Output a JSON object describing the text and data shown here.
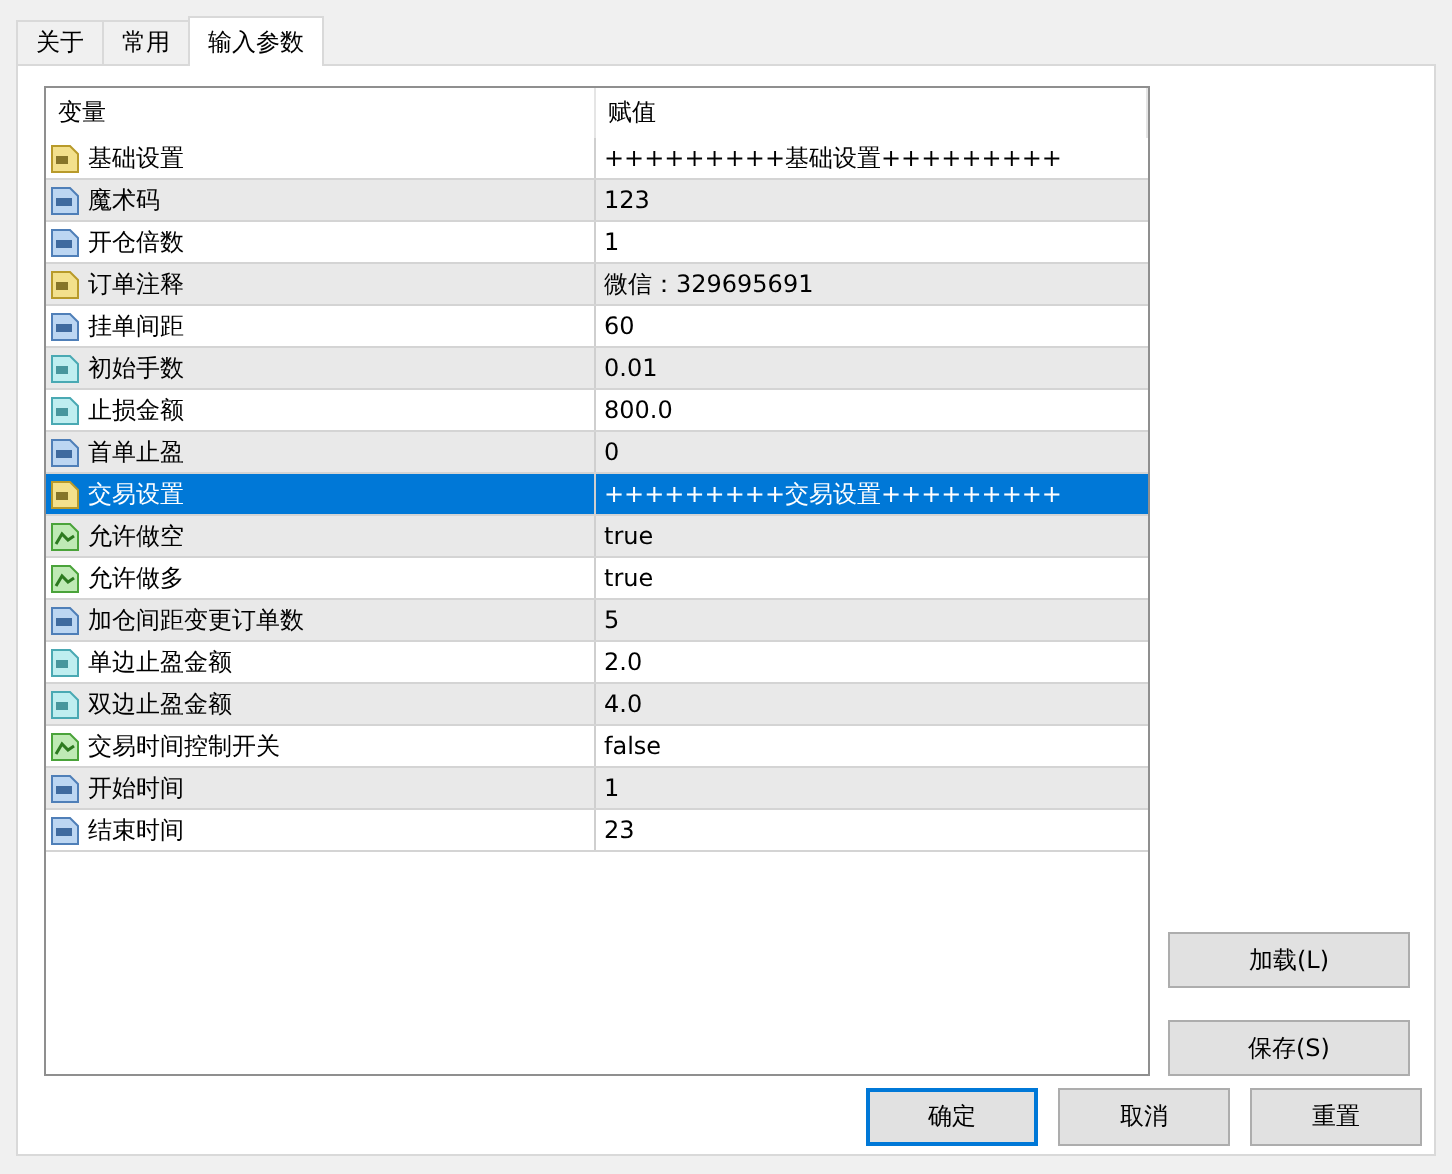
{
  "tabs": [
    {
      "label": "关于",
      "selected": false
    },
    {
      "label": "常用",
      "selected": false
    },
    {
      "label": "输入参数",
      "selected": true
    }
  ],
  "table": {
    "columns": [
      "变量",
      "赋值"
    ],
    "rows": [
      {
        "kind": "string",
        "name": "基础设置",
        "value": "+++++++++基础设置+++++++++",
        "selected": false
      },
      {
        "kind": "int",
        "name": "魔术码",
        "value": "123",
        "selected": false
      },
      {
        "kind": "int",
        "name": "开仓倍数",
        "value": "1",
        "selected": false
      },
      {
        "kind": "string",
        "name": "订单注释",
        "value": "微信：329695691",
        "selected": false
      },
      {
        "kind": "int",
        "name": "挂单间距",
        "value": "60",
        "selected": false
      },
      {
        "kind": "double",
        "name": "初始手数",
        "value": "0.01",
        "selected": false
      },
      {
        "kind": "double",
        "name": "止损金额",
        "value": "800.0",
        "selected": false
      },
      {
        "kind": "int",
        "name": "首单止盈",
        "value": "0",
        "selected": false
      },
      {
        "kind": "string",
        "name": "交易设置",
        "value": "+++++++++交易设置+++++++++",
        "selected": true
      },
      {
        "kind": "bool",
        "name": "允许做空",
        "value": "true",
        "selected": false
      },
      {
        "kind": "bool",
        "name": "允许做多",
        "value": "true",
        "selected": false
      },
      {
        "kind": "int",
        "name": "加仓间距变更订单数",
        "value": "5",
        "selected": false
      },
      {
        "kind": "double",
        "name": "单边止盈金额",
        "value": "2.0",
        "selected": false
      },
      {
        "kind": "double",
        "name": "双边止盈金额",
        "value": "4.0",
        "selected": false
      },
      {
        "kind": "bool",
        "name": "交易时间控制开关",
        "value": "false",
        "selected": false
      },
      {
        "kind": "int",
        "name": "开始时间",
        "value": "1",
        "selected": false
      },
      {
        "kind": "int",
        "name": "结束时间",
        "value": "23",
        "selected": false
      }
    ]
  },
  "side_buttons": [
    "加载(L)",
    "保存(S)"
  ],
  "buttons": [
    {
      "label": "确定",
      "default": true
    },
    {
      "label": "取消",
      "default": false
    },
    {
      "label": "重置",
      "default": false
    }
  ]
}
